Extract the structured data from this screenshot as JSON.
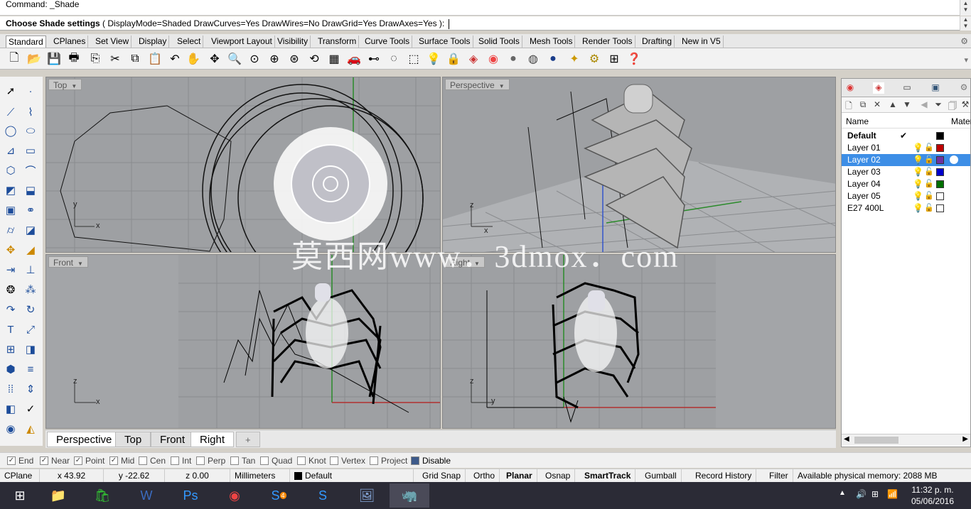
{
  "command_history": "Command: _Shade",
  "command_prompt": {
    "label": "Choose Shade settings",
    "options_text": "( DisplayMode=Shaded DrawCurves=Yes DrawWires=No DrawGrid=Yes DrawAxes=Yes ):"
  },
  "ribbon_tabs": [
    "Standard",
    "CPlanes",
    "Set View",
    "Display",
    "Select",
    "Viewport Layout",
    "Visibility",
    "Transform",
    "Curve Tools",
    "Surface Tools",
    "Solid Tools",
    "Mesh Tools",
    "Render Tools",
    "Drafting",
    "New in V5"
  ],
  "viewports": {
    "top": "Top",
    "perspective": "Perspective",
    "front": "Front",
    "right": "Right"
  },
  "viewport_tabs": [
    "Perspective",
    "Top",
    "Front",
    "Right"
  ],
  "add_tab_symbol": "+",
  "layers": {
    "header_name": "Name",
    "header_material": "Mater",
    "rows": [
      {
        "name": "Default",
        "color": "#000000",
        "current": true
      },
      {
        "name": "Layer 01",
        "color": "#c00000"
      },
      {
        "name": "Layer 02",
        "color": "#7030a0",
        "selected": true
      },
      {
        "name": "Layer 03",
        "color": "#0000cc"
      },
      {
        "name": "Layer 04",
        "color": "#007000"
      },
      {
        "name": "Layer 05",
        "color": "#ffffff"
      },
      {
        "name": "E27 400L",
        "color": "#ffffff"
      }
    ],
    "current_mark": "✔"
  },
  "osnaps": [
    {
      "label": "End",
      "checked": true
    },
    {
      "label": "Near",
      "checked": true
    },
    {
      "label": "Point",
      "checked": true
    },
    {
      "label": "Mid",
      "checked": true
    },
    {
      "label": "Cen",
      "checked": false
    },
    {
      "label": "Int",
      "checked": false
    },
    {
      "label": "Perp",
      "checked": false
    },
    {
      "label": "Tan",
      "checked": false
    },
    {
      "label": "Quad",
      "checked": false
    },
    {
      "label": "Knot",
      "checked": false
    },
    {
      "label": "Vertex",
      "checked": false
    },
    {
      "label": "Project",
      "checked": false
    },
    {
      "label": "Disable",
      "checked": false
    }
  ],
  "status": {
    "cplane": "CPlane",
    "x": "x 43.92",
    "y": "y -22.62",
    "z": "z 0.00",
    "units": "Millimeters",
    "layer": "Default",
    "grid_snap": "Grid Snap",
    "ortho": "Ortho",
    "planar": "Planar",
    "osnap": "Osnap",
    "smarttrack": "SmartTrack",
    "gumball": "Gumball",
    "record_history": "Record History",
    "filter": "Filter",
    "memory": "Available physical memory: 2088 MB"
  },
  "watermark": "莫西网www．3dmox．com",
  "taskbar": {
    "time": "11:32 p. m.",
    "date": "05/06/2016",
    "skype_badge": "4"
  },
  "axis_labels": {
    "x": "x",
    "y": "y",
    "z": "z"
  }
}
